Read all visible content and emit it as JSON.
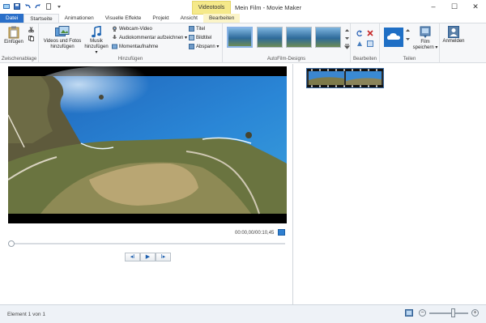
{
  "window": {
    "title": "Mein Film - Movie Maker",
    "context_tab": "Videotools",
    "controls": [
      "–",
      "☐",
      "✕"
    ]
  },
  "tabs": [
    "Datei",
    "Startseite",
    "Animationen",
    "Visuelle Effekte",
    "Projekt",
    "Ansicht",
    "Bearbeiten"
  ],
  "ribbon": {
    "zwischenablage": {
      "paste": "Einfügen",
      "group": "Zwischenablage"
    },
    "hinzufuegen": {
      "videos_fotos_line1": "Videos und Fotos",
      "videos_fotos_line2": "hinzufügen",
      "musik_line1": "Musik",
      "musik_line2": "hinzufügen ▾",
      "webcam": "Webcam-Video",
      "audiokommentar": "Audiokommentar aufzeichnen ▾",
      "momentaufnahme": "Momentaufnahme",
      "titel": "Titel",
      "bildtitel": "Bildtitel",
      "abspann": "Abspann ▾",
      "group": "Hinzufügen"
    },
    "autofilm": {
      "group": "AutoFilm-Designs"
    },
    "bearbeiten": {
      "group": "Bearbeiten"
    },
    "teilen": {
      "film_line1": "Film",
      "film_line2": "speichern ▾",
      "group": "Teilen"
    },
    "anmelden": "Anmelden"
  },
  "preview": {
    "timecode": "00:00,00/00:10,45",
    "controls": {
      "prev": "◂I",
      "play": "▶",
      "next": "I▸"
    }
  },
  "status": {
    "text": "Element 1 von 1",
    "zoom_minus": "−",
    "zoom_plus": "+",
    "zoom_level": 0.62
  },
  "colors": {
    "file_tab": "#2a6fc9",
    "context_tab": "#f5e98a",
    "onedrive": "#1f6fc5"
  }
}
